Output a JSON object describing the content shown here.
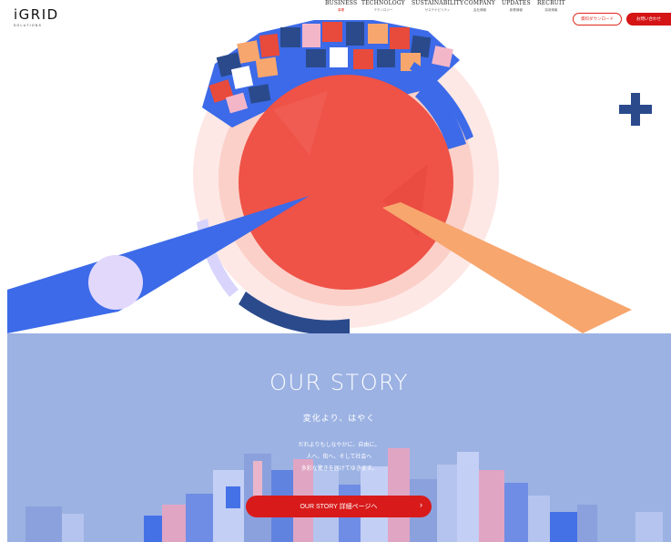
{
  "brand": {
    "logo": "iGRID",
    "tagline": "SOLUTIONS"
  },
  "nav": [
    {
      "en": "BUSINESS",
      "jp": "事業"
    },
    {
      "en": "TECHNOLOGY",
      "jp": "テクノロジー"
    },
    {
      "en": "SUSTAINABILITY",
      "jp": "サステナビリティ"
    },
    {
      "en": "COMPANY",
      "jp": "会社情報"
    },
    {
      "en": "UPDATES",
      "jp": "新着情報"
    },
    {
      "en": "RECRUIT",
      "jp": "採用情報"
    }
  ],
  "header": {
    "download": "資料ダウンロード",
    "contact": "お問い合わせ"
  },
  "hero": {
    "decor": [
      "plus-icon"
    ]
  },
  "story": {
    "title": "OUR STORY",
    "subtitle": "変化より、はやく",
    "lines": [
      "だれよりもしなやかに、自由に。",
      "人へ、街へ、そして社会へ",
      "多彩な驚きを届けてゆきます。"
    ],
    "button": "OUR STORY 詳細ページへ",
    "button_chevron": "›"
  },
  "colors": {
    "accent": "#e0251b",
    "blue": "#3a63e0",
    "navy": "#2a4a8c",
    "peach": "#f7a66e",
    "story_bg": "#9cb2e3"
  }
}
